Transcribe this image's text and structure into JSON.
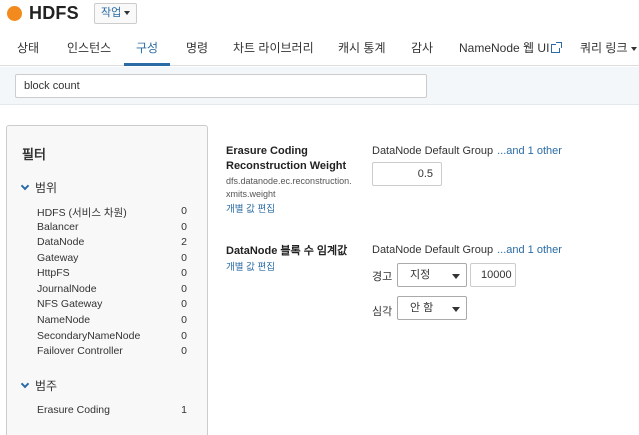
{
  "header": {
    "service_name": "HDFS",
    "actions_label": "작업",
    "status_color": "#f28a1e"
  },
  "tabs": [
    {
      "label": "상태",
      "active": false
    },
    {
      "label": "인스턴스",
      "active": false
    },
    {
      "label": "구성",
      "active": true
    },
    {
      "label": "명령",
      "active": false
    },
    {
      "label": "차트 라이브러리",
      "active": false
    },
    {
      "label": "캐시 통계",
      "active": false
    },
    {
      "label": "감사",
      "active": false
    },
    {
      "label": "NameNode 웹 UI",
      "active": false
    },
    {
      "label": "쿼리 링크",
      "active": false
    }
  ],
  "search": {
    "value": "block count"
  },
  "filters": {
    "title": "필터",
    "scope": {
      "heading": "범위",
      "items": [
        {
          "label": "HDFS (서비스 차원)",
          "count": "0"
        },
        {
          "label": "Balancer",
          "count": "0"
        },
        {
          "label": "DataNode",
          "count": "2"
        },
        {
          "label": "Gateway",
          "count": "0"
        },
        {
          "label": "HttpFS",
          "count": "0"
        },
        {
          "label": "JournalNode",
          "count": "0"
        },
        {
          "label": "NFS Gateway",
          "count": "0"
        },
        {
          "label": "NameNode",
          "count": "0"
        },
        {
          "label": "SecondaryNameNode",
          "count": "0"
        },
        {
          "label": "Failover Controller",
          "count": "0"
        }
      ]
    },
    "category": {
      "heading": "범주",
      "items": [
        {
          "label": "Erasure Coding",
          "count": "1"
        }
      ]
    }
  },
  "configs": [
    {
      "label_line1": "Erasure Coding",
      "label_line2": "Reconstruction Weight",
      "key_line1": "dfs.datanode.ec.reconstruction.",
      "key_line2": "xmits.weight",
      "edit_link": "개별 값 편집",
      "group": "DataNode Default Group",
      "more": "...and 1 other",
      "value": "0.5"
    },
    {
      "label": "DataNode 블록 수 임계값",
      "edit_link": "개별 값 편집",
      "group": "DataNode Default Group",
      "more": "...and 1 other",
      "warning_label": "경고",
      "warning_select": "지정",
      "warning_value": "10000",
      "critical_label": "심각",
      "critical_select": "안 함"
    }
  ]
}
